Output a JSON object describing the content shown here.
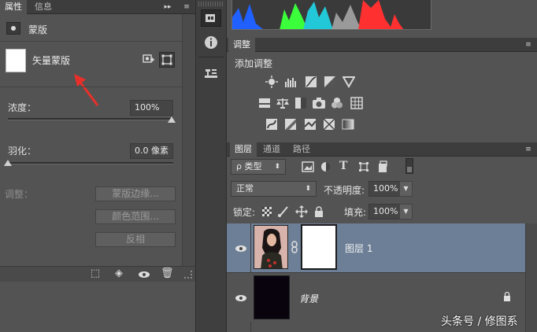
{
  "properties": {
    "tabs": [
      "属性",
      "信息"
    ],
    "mask_type_label": "蒙版",
    "vector_mask_label": "矢量蒙版",
    "density_label": "浓度：",
    "density_value": "100%",
    "density_level": 1.0,
    "feather_label": "羽化：",
    "feather_value": "0.0 像素",
    "feather_level": 0.0,
    "refine_label": "调整：",
    "mask_edge_button": "蒙版边缘...",
    "color_range_button": "颜色范围...",
    "invert_button": "反相"
  },
  "adjustments": {
    "tab": "调整",
    "add_label": "添加调整"
  },
  "layers": {
    "tabs": [
      "图层",
      "通道",
      "路径"
    ],
    "filter_kind": "ρ 类型",
    "blend_mode": "正常",
    "opacity_label": "不透明度:",
    "opacity_value": "100%",
    "lock_label": "锁定:",
    "fill_label": "填充:",
    "fill_value": "100%",
    "items": [
      {
        "name": "图层 1"
      },
      {
        "name": "背景"
      }
    ]
  },
  "watermark": "头条号 / 修图系",
  "colors": {
    "accent_arrow": "#e8302a",
    "selected_layer": "#6c7f96"
  }
}
